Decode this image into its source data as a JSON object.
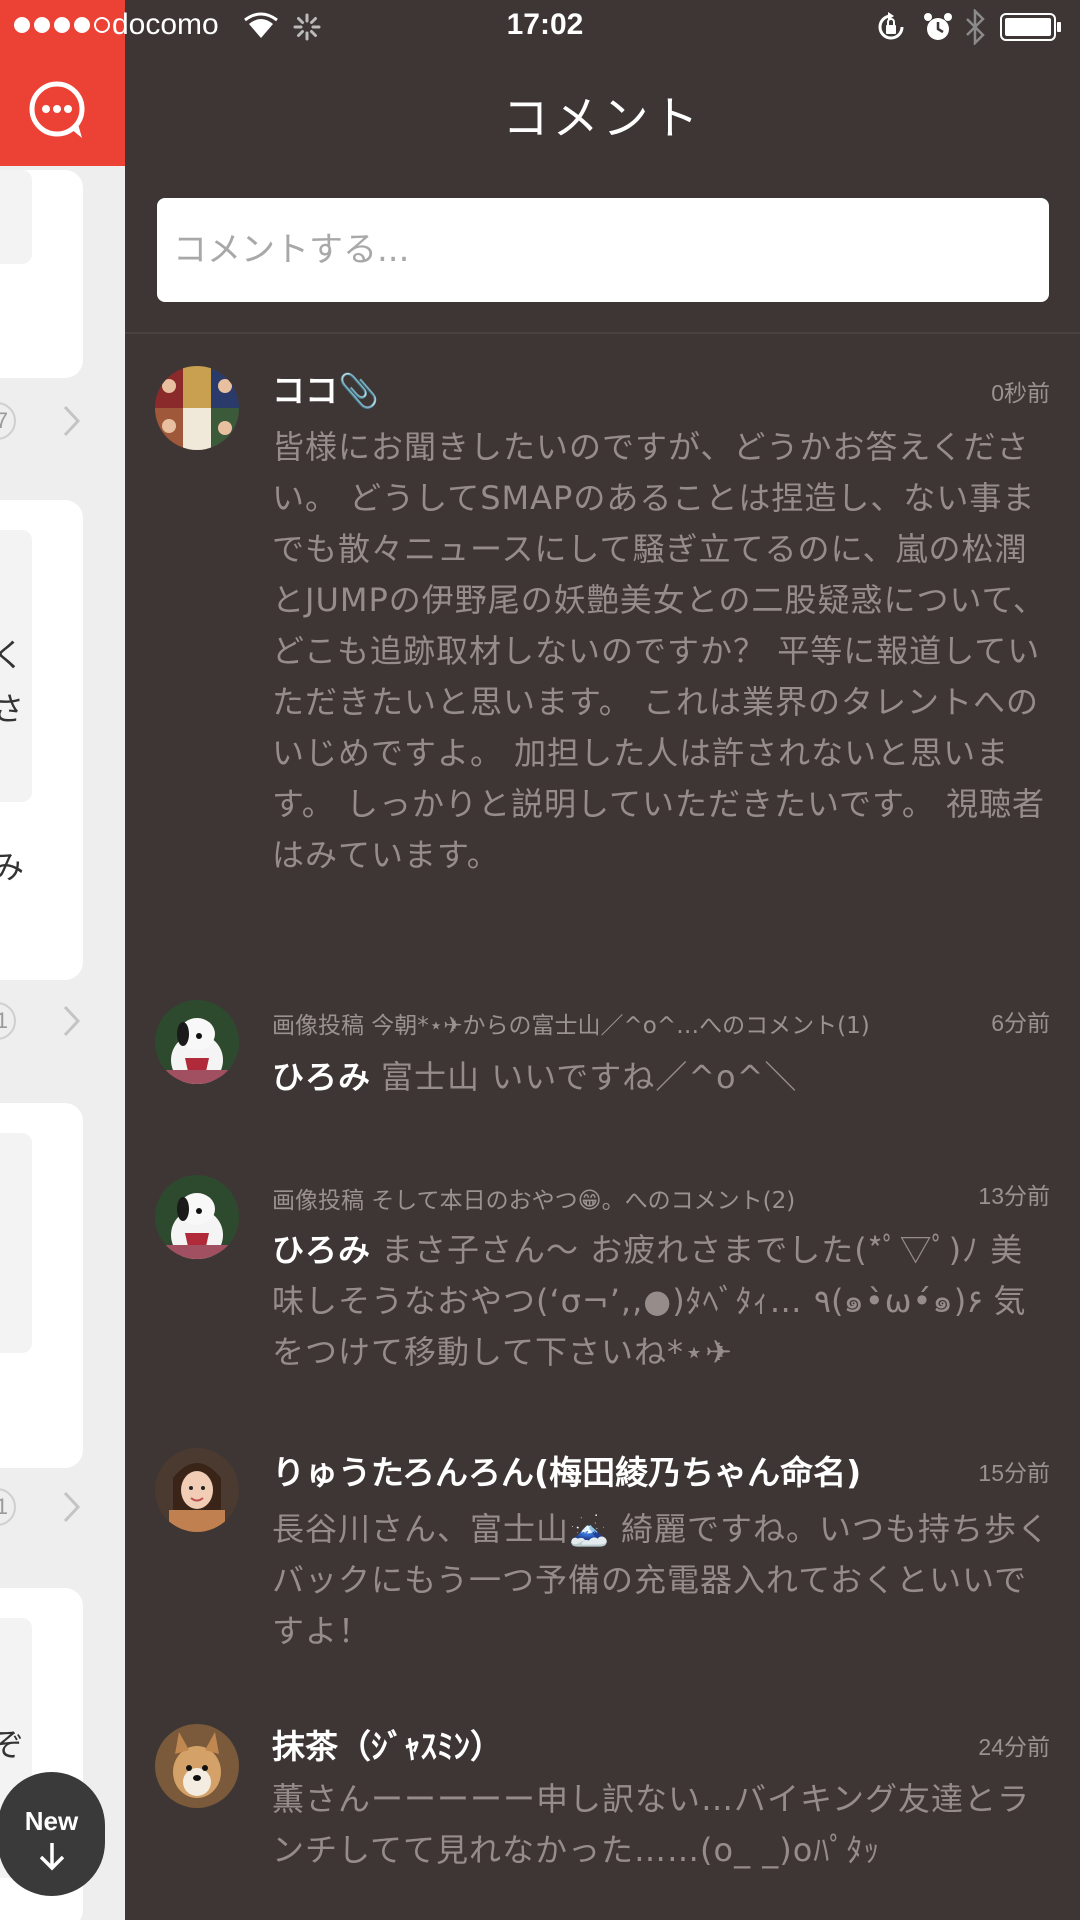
{
  "status_bar": {
    "carrier": "docomo",
    "time": "17:02"
  },
  "left_pane": {
    "row_counts": [
      "7",
      "1",
      "1"
    ],
    "peek_chars": [
      "く",
      "さ",
      "み",
      "ぞ"
    ],
    "new_button_label": "New"
  },
  "panel": {
    "title": "コメント",
    "input_placeholder": "コメントする..."
  },
  "comments": [
    {
      "name": "ココ📎",
      "time": "0秒前",
      "context": "",
      "body": "皆様にお聞きしたいのですが、どうかお答えください。 どうしてSMAPのあることは捏造し、ない事までも散々ニュースにして騒ぎ立てるのに、嵐の松潤とJUMPの伊野尾の妖艶美女との二股疑惑について、どこも追跡取材しないのですか？ 平等に報道していただきたいと思います。 これは業界のタレントへのいじめですよ。 加担した人は許されないと思います。 しっかりと説明していただきたいです。 視聴者はみています。"
    },
    {
      "name": "ひろみ",
      "time": "6分前",
      "context": "画像投稿 今朝*⋆✈からの富士山／^o^…へのコメント(1)",
      "body": "富士山 いいですね／^o^＼"
    },
    {
      "name": "ひろみ",
      "time": "13分前",
      "context": "画像投稿 そして本日のおやつ😁。へのコメント(2)",
      "body": "まさ子さん〜 お疲れさまでした(*ﾟ▽ﾟ)ﾉ 美味しそうなおやつ(‘σ¬’,,●)ﾀﾍﾞﾀｨ… ٩(๑•̀ω•́๑)۶ 気をつけて移動して下さいね*⋆✈"
    },
    {
      "name": "りゅうたろんろん(梅田綾乃ちゃん命名)",
      "time": "15分前",
      "context": "",
      "body": "長谷川さん、富士山🗻 綺麗ですね。いつも持ち歩くバックにもう一つ予備の充電器入れておくといいですよ！"
    },
    {
      "name": "抹茶（ｼﾞｬｽﾐﾝ）",
      "time": "24分前",
      "context": "",
      "body": "薫さんーーーーー申し訳ない…バイキング友達とランチしてて見れなかった……(o_ _)oﾊﾟﾀｯ"
    }
  ],
  "colors": {
    "panel_bg": "#3e3635",
    "accent_red": "#ec4235",
    "name_text": "#ffffff",
    "body_text": "#968d8b",
    "meta_text": "#9a9290"
  },
  "icons": [
    "chat-bubble-icon",
    "wifi-icon",
    "activity-spinner-icon",
    "rotation-lock-icon",
    "alarm-icon",
    "bluetooth-icon",
    "battery-icon",
    "chevron-right-icon",
    "arrow-down-icon"
  ]
}
